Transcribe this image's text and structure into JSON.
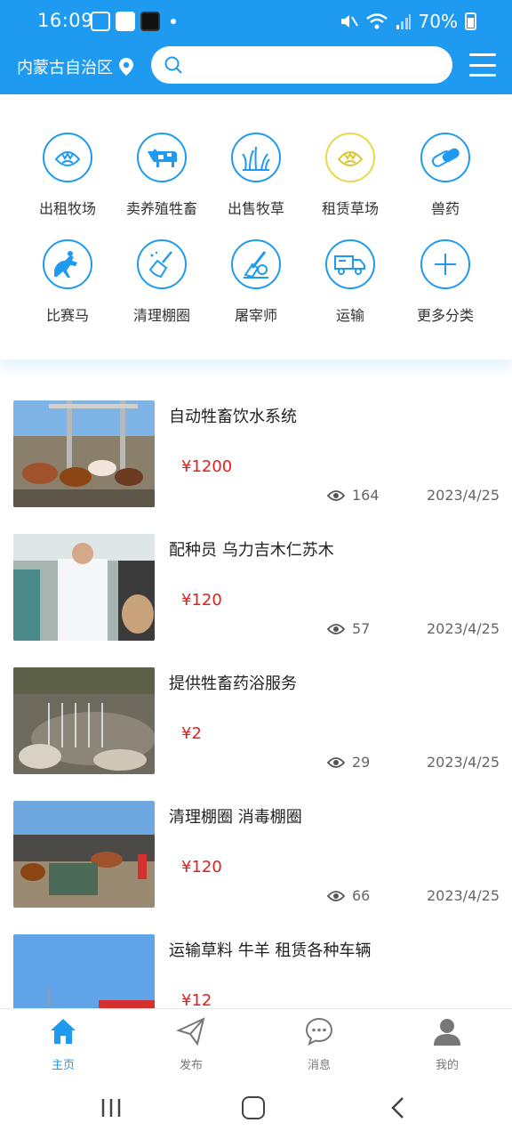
{
  "status_bar": {
    "time": "16:09",
    "battery": "70%"
  },
  "header": {
    "region": "内蒙古自治区",
    "search_placeholder": ""
  },
  "categories": [
    {
      "label": "出租牧场",
      "icon": "pasture-icon"
    },
    {
      "label": "卖养殖牲畜",
      "icon": "cow-icon"
    },
    {
      "label": "出售牧草",
      "icon": "grass-icon"
    },
    {
      "label": "租赁草场",
      "icon": "grassland-icon"
    },
    {
      "label": "兽药",
      "icon": "pill-icon"
    },
    {
      "label": "比赛马",
      "icon": "horse-racing-icon"
    },
    {
      "label": "清理棚圈",
      "icon": "broom-icon"
    },
    {
      "label": "屠宰师",
      "icon": "cleaver-icon"
    },
    {
      "label": "运输",
      "icon": "truck-icon"
    },
    {
      "label": "更多分类",
      "icon": "plus-icon"
    }
  ],
  "listings": [
    {
      "title": "自动牲畜饮水系统",
      "price": "¥1200",
      "views": "164",
      "date": "2023/4/25"
    },
    {
      "title": "配种员 乌力吉木仁苏木",
      "price": "¥120",
      "views": "57",
      "date": "2023/4/25"
    },
    {
      "title": "提供牲畜药浴服务",
      "price": "¥2",
      "views": "29",
      "date": "2023/4/25"
    },
    {
      "title": "清理棚圈 消毒棚圈",
      "price": "¥120",
      "views": "66",
      "date": "2023/4/25"
    },
    {
      "title": "运输草料 牛羊 租赁各种车辆",
      "price": "¥12",
      "views": "",
      "date": ""
    }
  ],
  "tabbar": [
    {
      "label": "主页",
      "icon": "home-icon",
      "active": true
    },
    {
      "label": "发布",
      "icon": "send-icon",
      "active": false
    },
    {
      "label": "消息",
      "icon": "message-icon",
      "active": false
    },
    {
      "label": "我的",
      "icon": "user-icon",
      "active": false
    }
  ],
  "colors": {
    "primary": "#1e9bf0",
    "price": "#e02020",
    "accent_yellow": "#e8d84a"
  }
}
